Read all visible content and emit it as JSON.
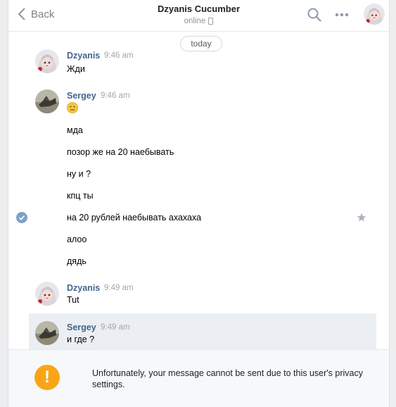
{
  "header": {
    "back_label": "Back",
    "title": "Dzyanis Cucumber",
    "status": "online"
  },
  "date_label": "today",
  "messages": [
    {
      "author": "Dzyanis",
      "time": "9:46 am",
      "lines": [
        "Жди"
      ]
    },
    {
      "author": "Sergey",
      "time": "9:46 am",
      "emoji": "neutral-face",
      "lines": [
        "мда",
        "позор же на 20 наебывать",
        "ну и ?",
        "кпц ты",
        "на 20 рублей наебывать ахахаха",
        "алоо",
        "дядь"
      ]
    },
    {
      "author": "Dzyanis",
      "time": "9:49 am",
      "lines": [
        "Tut"
      ]
    },
    {
      "author": "Sergey",
      "time": "9:49 am",
      "lines": [
        "и где ?"
      ]
    }
  ],
  "footer": {
    "warning": "Unfortunately, your message cannot be sent due to this user's privacy settings.",
    "icon": "!"
  },
  "colors": {
    "accent_link": "#42648b",
    "warning": "#f9a516",
    "selected_check": "#7da1c8"
  }
}
